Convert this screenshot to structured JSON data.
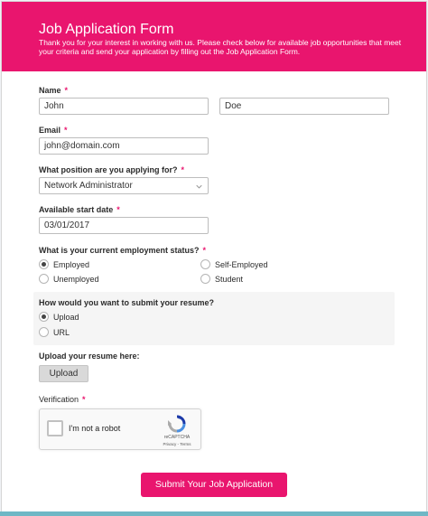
{
  "header": {
    "title": "Job Application Form",
    "description": "Thank you for your interest in working with us. Please check below for available job opportunities that meet your criteria and send your application by filling out the Job Application Form.",
    "color": "#e9156e"
  },
  "name": {
    "label": "Name",
    "required_mark": "*",
    "first": "John",
    "last": "Doe"
  },
  "email": {
    "label": "Email",
    "required_mark": "*",
    "value": "john@domain.com"
  },
  "position": {
    "label": "What position are you applying for?",
    "required_mark": "*",
    "selected": "Network Administrator",
    "icon": "chevron-down-icon"
  },
  "start_date": {
    "label": "Available start date",
    "required_mark": "*",
    "value": "03/01/2017"
  },
  "employment": {
    "label": "What is your current employment status?",
    "required_mark": "*",
    "options": [
      "Employed",
      "Self-Employed",
      "Unemployed",
      "Student"
    ],
    "selected": "Employed"
  },
  "resume_method": {
    "label": "How would you want to submit your resume?",
    "options": [
      "Upload",
      "URL"
    ],
    "selected": "Upload"
  },
  "upload": {
    "label": "Upload your resume here:",
    "button": "Upload"
  },
  "verification": {
    "label": "Verification",
    "required_mark": "*",
    "captcha_text": "I'm not a robot",
    "captcha_brand": "reCAPTCHA",
    "captcha_links": "Privacy - Terms"
  },
  "submit_label": "Submit Your Job Application"
}
